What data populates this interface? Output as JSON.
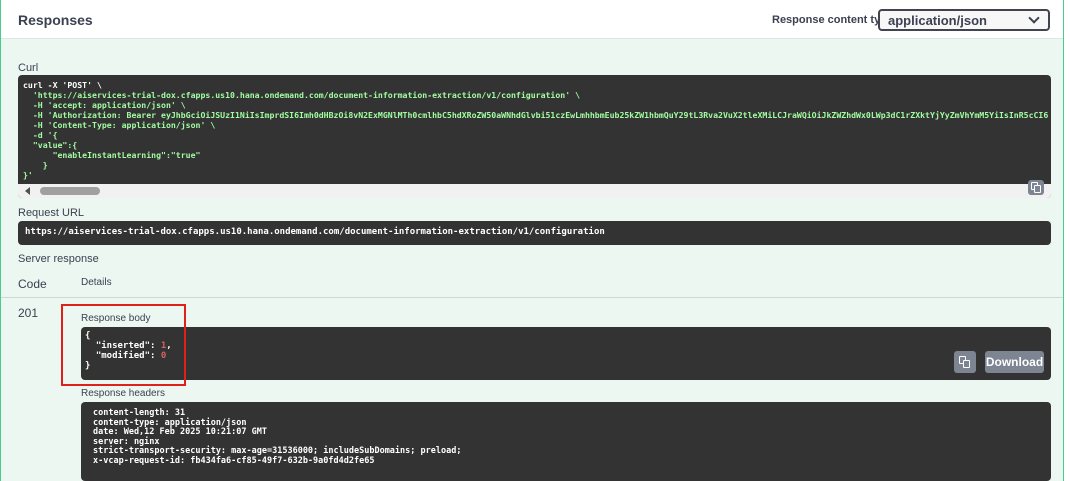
{
  "responses": {
    "title": "Responses",
    "content_type_label": "Response content type",
    "content_type_value": "application/json"
  },
  "curl": {
    "label": "Curl",
    "lines": [
      "curl -X 'POST' \\",
      "  'https://aiservices-trial-dox.cfapps.us10.hana.ondemand.com/document-information-extraction/v1/configuration' \\",
      "  -H 'accept: application/json' \\",
      "  -H 'Authorization: Bearer eyJhbGciOiJSUzI1NiIsImprdSI6Imh0dHBzOi8vN2ExMGNlMTh0cmlhbC5hdXRoZW50aWNhdGlvbi51czEwLmhhbmEub25kZW1hbmQuY29tL3Rva2VuX2tleXMiLCJraWQiOiJkZWZhdWx0LWp3dC1rZXktYjYyZmVhYmM5YiIsInR5cCI6",
      "  -H 'Content-Type: application/json' \\",
      "  -d '{",
      "  \"value\":{",
      "      \"enableInstantLearning\":\"true\"",
      "    }",
      "}'"
    ]
  },
  "request_url": {
    "label": "Request URL",
    "value": "https://aiservices-trial-dox.cfapps.us10.hana.ondemand.com/document-information-extraction/v1/configuration"
  },
  "server_response": {
    "label": "Server response",
    "col_code": "Code",
    "col_details": "Details",
    "code": "201",
    "body_label": "Response body",
    "body_open": "{",
    "body_line1_key": "  \"inserted\": ",
    "body_line1_val": "1",
    "body_line1_end": ",",
    "body_line2_key": "  \"modified\": ",
    "body_line2_val": "0",
    "body_close": "}",
    "download_label": "Download",
    "headers_label": "Response headers",
    "headers": [
      "content-length: 31",
      "content-type: application/json",
      "date: Wed,12 Feb 2025 10:21:07 GMT",
      "server: nginx",
      "strict-transport-security: max-age=31536000; includeSubDomains; preload;",
      "x-vcap-request-id: fb434fa6-cf85-49f7-632b-9a0fd4d2fe65"
    ]
  },
  "colors": {
    "accent_green": "#49cc90",
    "code_bg": "#333333",
    "string_green": "#a2fca2",
    "number_red": "#d36363",
    "highlight": "#e0201b"
  }
}
